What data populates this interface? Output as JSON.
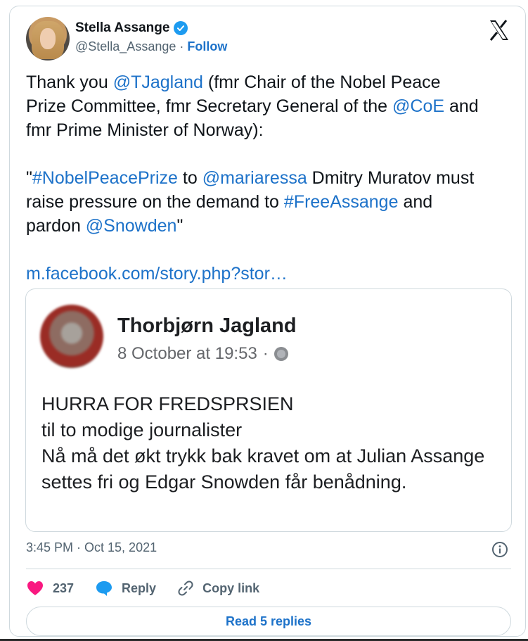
{
  "author": {
    "name": "Stella Assange",
    "handle": "@Stella_Assange",
    "separator": "·",
    "follow_label": "Follow"
  },
  "tweet": {
    "segments": [
      {
        "text": "Thank you ",
        "type": "text"
      },
      {
        "text": "@TJagland",
        "type": "link"
      },
      {
        "text": " (fmr Chair of the Nobel Peace\nPrize Committee, fmr Secretary General of the ",
        "type": "text"
      },
      {
        "text": "@CoE",
        "type": "link"
      },
      {
        "text": " and\nfmr Prime Minister of Norway):\n\n\"",
        "type": "text"
      },
      {
        "text": "#NobelPeacePrize",
        "type": "link"
      },
      {
        "text": " to ",
        "type": "text"
      },
      {
        "text": "@mariaressa",
        "type": "link"
      },
      {
        "text": " Dmitry Muratov must\nraise pressure on the demand to ",
        "type": "text"
      },
      {
        "text": "#FreeAssange",
        "type": "link"
      },
      {
        "text": " and\npardon ",
        "type": "text"
      },
      {
        "text": "@Snowden",
        "type": "link"
      },
      {
        "text": "\"\n\n",
        "type": "text"
      },
      {
        "text": "m.facebook.com/story.php?stor…",
        "type": "link"
      }
    ]
  },
  "embed": {
    "author_name": "Thorbjørn Jagland",
    "date": "8 October at 19:53",
    "dot": "·",
    "body_lines": [
      "HURRA FOR FREDSPRSIEN",
      "til to modige journalister",
      "Nå må det økt trykk bak kravet om at Julian Assange",
      "settes fri og Edgar Snowden får benådning."
    ]
  },
  "timestamp": "3:45 PM · Oct 15, 2021",
  "actions": {
    "like_count": "237",
    "reply_label": "Reply",
    "copy_label": "Copy link"
  },
  "read_replies_label": "Read 5 replies",
  "colors": {
    "accent": "#1d9bf0",
    "link": "#1d72c9",
    "like": "#f91880"
  }
}
